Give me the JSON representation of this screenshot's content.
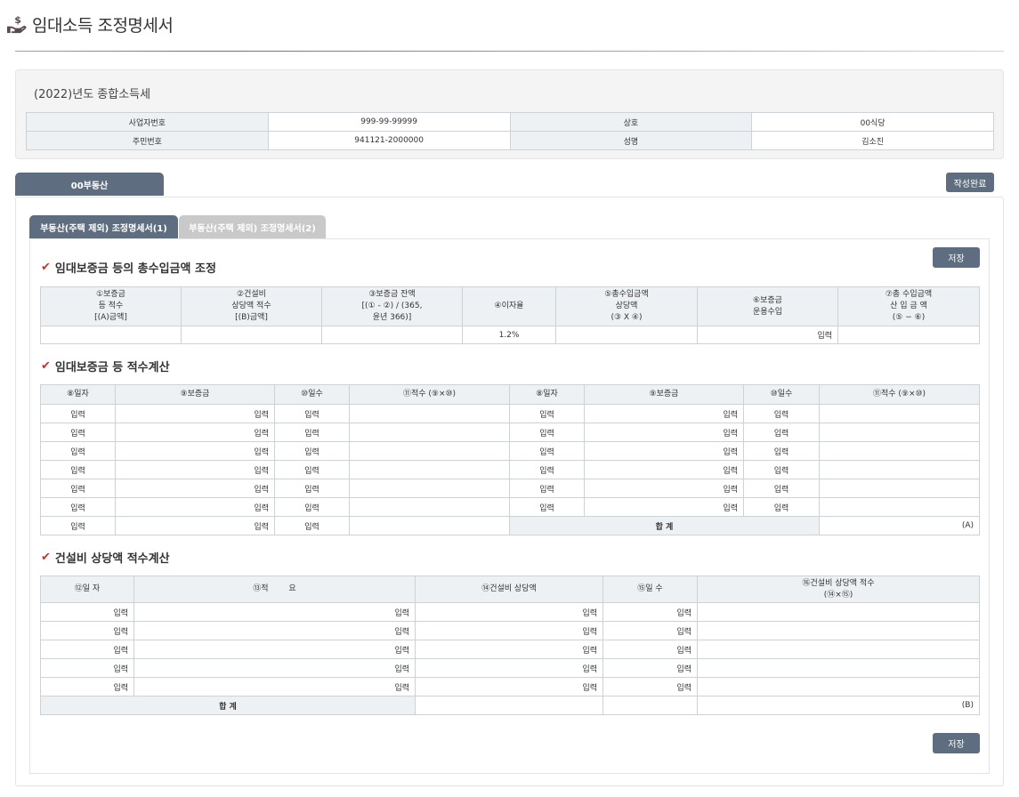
{
  "page": {
    "title": "임대소득 조정명세서"
  },
  "info": {
    "subtitle": "(2022)년도 종합소득세",
    "rows": [
      {
        "label1": "사업자번호",
        "value1": "999-99-99999",
        "label2": "상호",
        "value2": "00식당"
      },
      {
        "label1": "주민번호",
        "value1": "941121-2000000",
        "label2": "성명",
        "value2": "김소진"
      }
    ]
  },
  "tabs": {
    "main": "00부동산",
    "complete_button": "작성완료"
  },
  "subtabs": [
    "부동산(주택 제외) 조정명세서(1)",
    "부동산(주택 제외) 조정명세서(2)"
  ],
  "save_label": "저장",
  "placeholder": "입력",
  "section1": {
    "title": "임대보증금 등의 총수입금액 조정",
    "headers": [
      [
        "①보증금",
        "등 적수",
        "[(A)금액]"
      ],
      [
        "②건설비",
        "상당액 적수",
        "[(B)금액]"
      ],
      [
        "③보증금 잔액",
        "[(① - ②) / (365,",
        "윤년 366)]"
      ],
      [
        "④이자율"
      ],
      [
        "⑤총수입금액",
        "상당액",
        "(③ X ④)"
      ],
      [
        "⑥보증금",
        "운용수입"
      ],
      [
        "⑦총 수입금액",
        "산 입 금 액",
        "(⑤ − ⑥)"
      ]
    ],
    "rate": "1.2%",
    "op_income_placeholder": "입력"
  },
  "section2": {
    "title": "임대보증금 등 적수계산",
    "headers": [
      "⑧일자",
      "⑨보증금",
      "⑩일수",
      "⑪적수 (⑨×⑩)",
      "⑧일자",
      "⑨보증금",
      "⑩일수",
      "⑪적수 (⑨×⑩)"
    ],
    "total_label": "합 계",
    "total_mark": "(A)"
  },
  "section3": {
    "title": "건설비 상당액 적수계산",
    "headers": [
      "⑫일 자",
      "⑬적        요",
      "⑭건설비 상당액",
      "⑮일 수",
      "⑯건설비 상당액 적수",
      "(⑭×⑮)"
    ],
    "total_label": "합 계",
    "total_mark": "(B)"
  },
  "colors": {
    "tab_active": "#5e6e80",
    "tab_inactive": "#c9c9c9",
    "check": "#c0392b",
    "header_bg": "#eef1f4"
  }
}
